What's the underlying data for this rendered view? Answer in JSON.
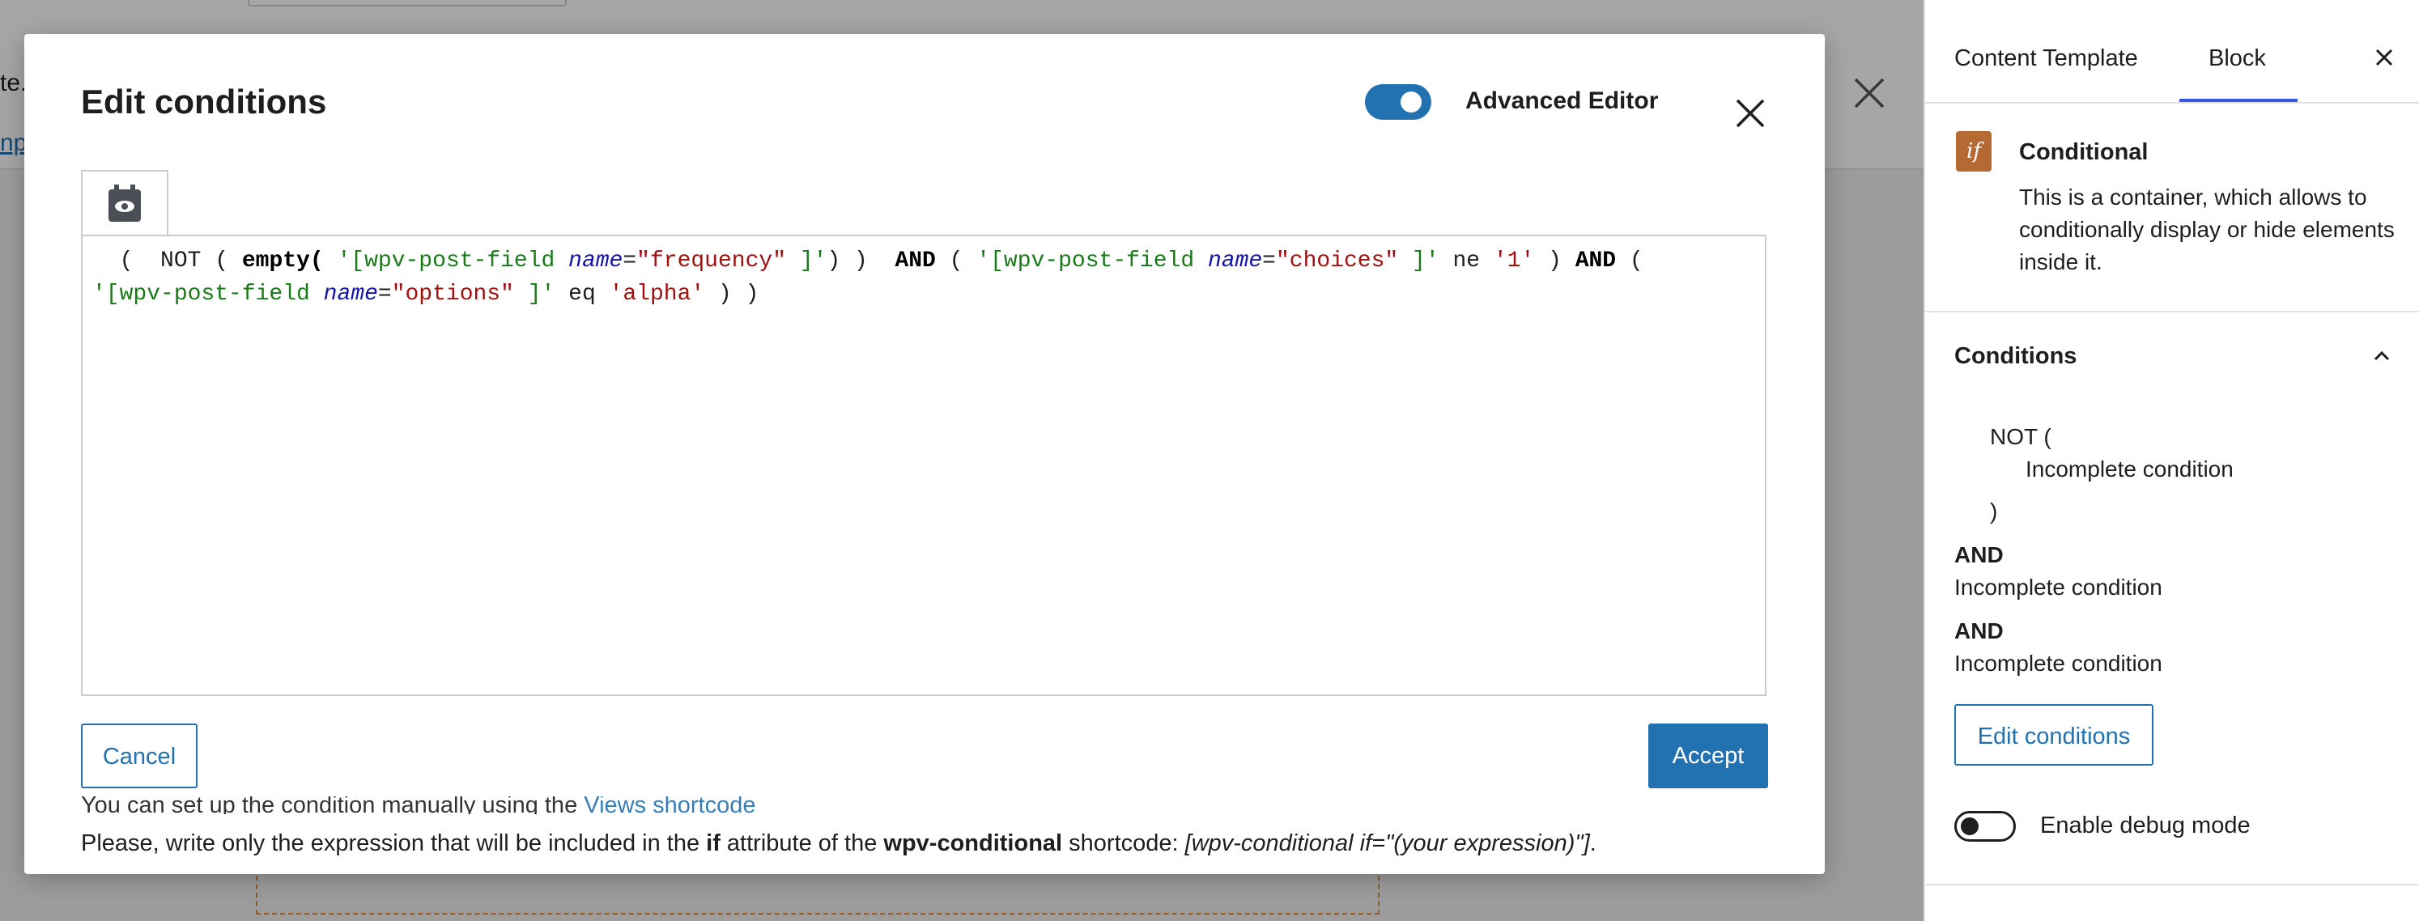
{
  "background": {
    "text_fragment_1": "te.",
    "text_fragment_2": "npl"
  },
  "modal": {
    "title": "Edit conditions",
    "advanced_editor_label": "Advanced Editor",
    "advanced_editor_on": true,
    "code_tokens": [
      {
        "t": "  (  NOT ( ",
        "c": "plain"
      },
      {
        "t": "empty(",
        "c": "kw"
      },
      {
        "t": " ",
        "c": "plain"
      },
      {
        "t": "'[wpv-post-field ",
        "c": "str"
      },
      {
        "t": "name",
        "c": "attr"
      },
      {
        "t": "=",
        "c": "plain"
      },
      {
        "t": "\"frequency\"",
        "c": "val"
      },
      {
        "t": " ]'",
        "c": "str"
      },
      {
        "t": ") )  ",
        "c": "plain"
      },
      {
        "t": "AND",
        "c": "kw"
      },
      {
        "t": " ( ",
        "c": "plain"
      },
      {
        "t": "'[wpv-post-field ",
        "c": "str"
      },
      {
        "t": "name",
        "c": "attr"
      },
      {
        "t": "=",
        "c": "plain"
      },
      {
        "t": "\"choices\"",
        "c": "val"
      },
      {
        "t": " ]'",
        "c": "str"
      },
      {
        "t": " ne ",
        "c": "plain"
      },
      {
        "t": "'1'",
        "c": "val"
      },
      {
        "t": " ) ",
        "c": "plain"
      },
      {
        "t": "AND",
        "c": "kw"
      },
      {
        "t": " (\n",
        "c": "plain"
      },
      {
        "t": "'[wpv-post-field ",
        "c": "str"
      },
      {
        "t": "name",
        "c": "attr"
      },
      {
        "t": "=",
        "c": "plain"
      },
      {
        "t": "\"options\"",
        "c": "val"
      },
      {
        "t": " ]'",
        "c": "str"
      },
      {
        "t": " eq ",
        "c": "plain"
      },
      {
        "t": "'alpha'",
        "c": "val"
      },
      {
        "t": " ) )",
        "c": "plain"
      }
    ],
    "cancel_label": "Cancel",
    "accept_label": "Accept",
    "help_line_1_prefix": "You can set up the condition manually using the ",
    "help_line_1_link": "Views shortcode",
    "help_line_2_prefix": "Please, write only the expression that will be included in the ",
    "help_line_2_if": "if",
    "help_line_2_mid": " attribute of the ",
    "help_line_2_code": "wpv-conditional",
    "help_line_2_mid2": " shortcode: ",
    "help_line_2_example": "[wpv-conditional if=\"(your expression)\"]",
    "help_line_2_end": "."
  },
  "sidebar": {
    "tab_content_template": "Content Template",
    "tab_block": "Block",
    "block_icon_text": "if",
    "block_title": "Conditional",
    "block_description": "This is a container, which allows to conditionally display or hide elements inside it.",
    "conditions_title": "Conditions",
    "not_open": "NOT (",
    "incomplete_1": "Incomplete condition",
    "not_close": ")",
    "and_1": "AND",
    "incomplete_2": "Incomplete condition",
    "and_2": "AND",
    "incomplete_3": "Incomplete condition",
    "edit_conditions_label": "Edit conditions",
    "debug_label": "Enable debug mode",
    "debug_on": false
  },
  "colors": {
    "accent": "#2271b1",
    "tab_underline": "#3858e9",
    "block_icon": "#b66a33",
    "code_string": "#1a7a1a",
    "code_attr": "#1414a8",
    "code_value": "#a11111"
  }
}
